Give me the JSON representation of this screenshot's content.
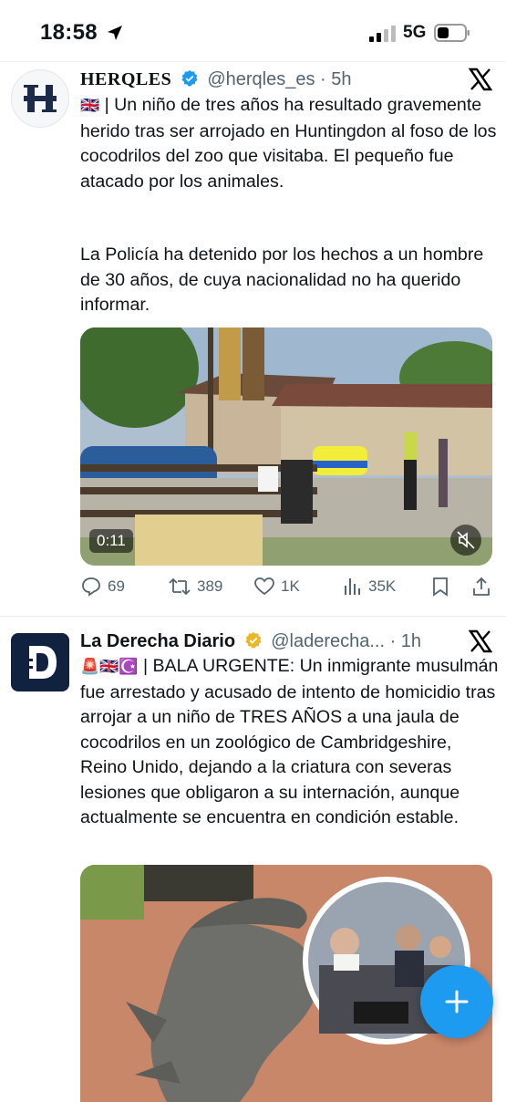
{
  "status_bar": {
    "time": "18:58",
    "network": "5G"
  },
  "tweets": [
    {
      "author": "HERQLES",
      "handle": "@herqles_es",
      "time": "· 5h",
      "flags": "🇬🇧",
      "text_p1": " | Un niño de tres años ha resultado gravemente herido tras ser arrojado en Huntingdon al foso de los cocodrilos del zoo que visitaba. El pequeño fue atacado por los animales.",
      "text_p2": "La Policía ha detenido por los hechos a un hombre de 30 años, de cuya nacionalidad no ha querido informar.",
      "video_duration": "0:11",
      "stats": {
        "replies": "69",
        "reposts": "389",
        "likes": "1K",
        "views": "35K"
      }
    },
    {
      "author": "La Derecha Diario",
      "handle": "@laderecha...",
      "time": "· 1h",
      "flags": "🚨🇬🇧☪️",
      "text": " | BALA URGENTE: Un inmigrante musulmán fue arrestado y acusado de intento de homicidio tras arrojar a un niño de TRES AÑOS a una jaula de cocodrilos en un zoológico de Cambridgeshire, Reino Unido, dejando a la criatura con severas lesiones que obligaron a su internación, aunque actualmente se encuentra en condición estable."
    }
  ],
  "colors": {
    "accent": "#1d9bf0",
    "text": "#0f1419",
    "secondary": "#536471",
    "verified_gold": "#e8b829"
  },
  "icons": [
    "location-arrow-icon",
    "signal-icon",
    "battery-icon",
    "verified-icon",
    "x-logo-icon",
    "reply-icon",
    "repost-icon",
    "like-icon",
    "views-icon",
    "bookmark-icon",
    "share-icon",
    "mute-icon",
    "compose-plus-icon"
  ]
}
